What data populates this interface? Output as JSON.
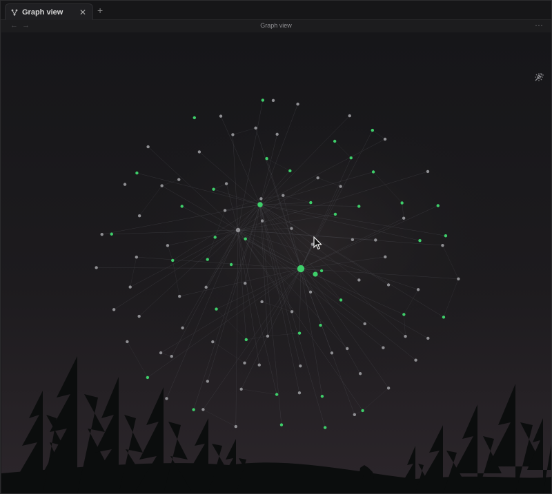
{
  "tab": {
    "label": "Graph view",
    "icon": "graph-icon",
    "close_icon": "close-icon",
    "new_tab_icon": "plus-icon"
  },
  "header": {
    "title": "Graph view",
    "back_icon": "arrow-left-icon",
    "forward_icon": "arrow-right-icon",
    "more_icon": "more-horizontal-icon"
  },
  "controls": {
    "settings_icon": "gear-icon",
    "animate_icon": "magic-wand-icon"
  },
  "colors": {
    "accent_node": "#3ecf6a",
    "plain_node": "#8f8f93",
    "edge": "#4a4a50",
    "sky_top": "#17171a",
    "sky_bottom": "#2a2529",
    "tree": "#0c0e0e"
  }
}
